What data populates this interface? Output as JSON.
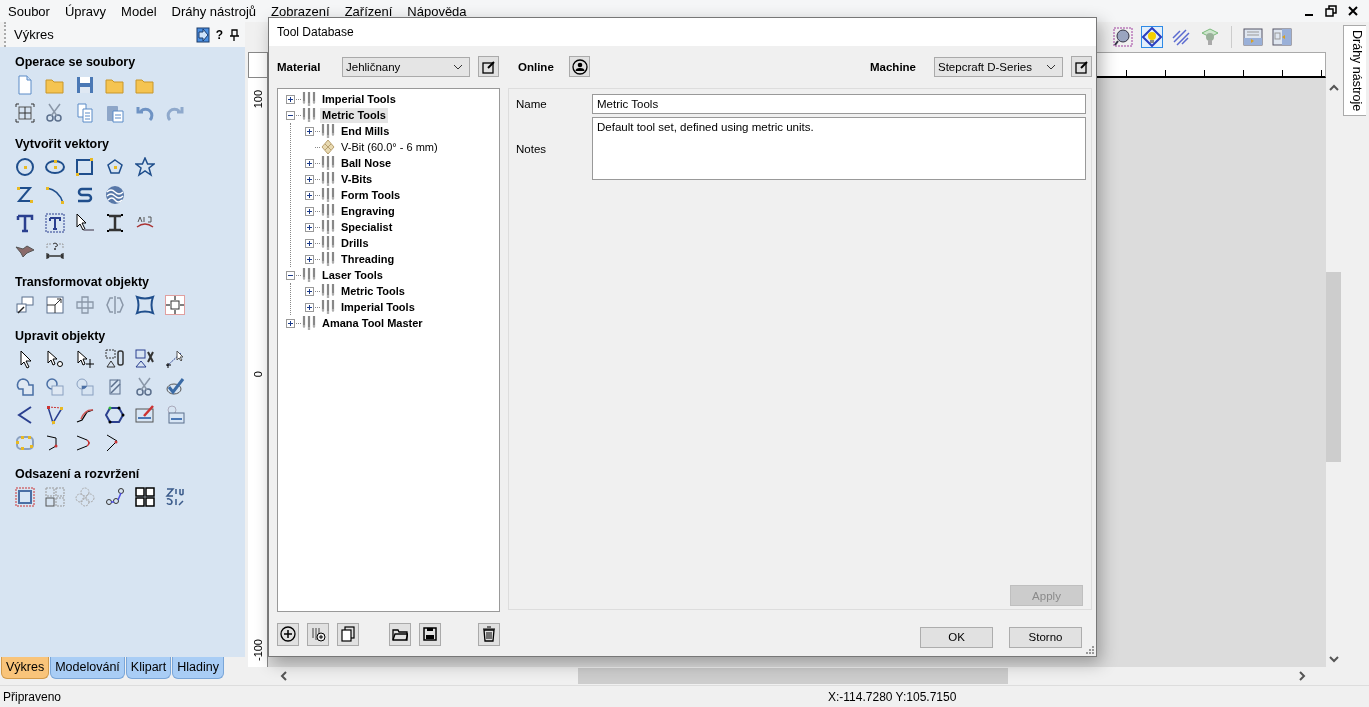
{
  "menu": [
    "Soubor",
    "Úpravy",
    "Model",
    "Dráhy nástrojů",
    "Zobrazení",
    "Zařízení",
    "Nápověda"
  ],
  "left_panel": {
    "title": "Výkres",
    "help": "?",
    "sections": [
      "Operace se soubory",
      "Vytvořit vektory",
      "Transformovat objekty",
      "Upravit objekty",
      "Odsazení a rozvržení"
    ]
  },
  "bottom_tabs": [
    {
      "label": "Výkres",
      "selected": true
    },
    {
      "label": "Modelování",
      "selected": false
    },
    {
      "label": "Klipart",
      "selected": false
    },
    {
      "label": "Hladiny",
      "selected": false
    }
  ],
  "toolbar_buttons": [
    {
      "selected": false
    },
    {
      "selected": true
    },
    {
      "selected": false
    },
    {
      "selected": false
    },
    {
      "selected": false
    },
    {
      "selected": false
    }
  ],
  "ruler_labels": [
    "100",
    "0",
    "-100"
  ],
  "right_tab": {
    "label": "Dráhy nástroje"
  },
  "dialog": {
    "title": "Tool Database",
    "material": {
      "label": "Material",
      "value": "Jehličnany"
    },
    "online": {
      "label": "Online"
    },
    "machine": {
      "label": "Machine",
      "value": "Stepcraft D-Series"
    },
    "tree": [
      {
        "label": "Imperial Tools",
        "kind": "group",
        "expanded": false,
        "selected": false
      },
      {
        "label": "Metric Tools",
        "kind": "group",
        "expanded": true,
        "selected": true,
        "children": [
          {
            "label": "End Mills",
            "kind": "group",
            "expanded": false,
            "selected": false
          },
          {
            "label": "V-Bit (60.0° - 6 mm)",
            "kind": "tool",
            "selected": false
          },
          {
            "label": "Ball Nose",
            "kind": "group",
            "expanded": false,
            "selected": false
          },
          {
            "label": "V-Bits",
            "kind": "group",
            "expanded": false,
            "selected": false
          },
          {
            "label": "Form Tools",
            "kind": "group",
            "expanded": false,
            "selected": false
          },
          {
            "label": "Engraving",
            "kind": "group",
            "expanded": false,
            "selected": false
          },
          {
            "label": "Specialist",
            "kind": "group",
            "expanded": false,
            "selected": false
          },
          {
            "label": "Drills",
            "kind": "group",
            "expanded": false,
            "selected": false
          },
          {
            "label": "Threading",
            "kind": "group",
            "expanded": false,
            "selected": false
          }
        ]
      },
      {
        "label": "Laser Tools",
        "kind": "group",
        "expanded": true,
        "selected": false,
        "children": [
          {
            "label": "Metric Tools",
            "kind": "group",
            "expanded": false,
            "selected": false
          },
          {
            "label": "Imperial Tools",
            "kind": "group",
            "expanded": false,
            "selected": false
          }
        ]
      },
      {
        "label": "Amana Tool Master",
        "kind": "group",
        "expanded": false,
        "selected": false
      }
    ],
    "details": {
      "name_label": "Name",
      "name_value": "Metric Tools",
      "notes_label": "Notes",
      "notes_value": "Default tool set, defined using metric units."
    },
    "apply": {
      "label": "Apply",
      "disabled": true
    },
    "buttons": [
      "OK",
      "Storno"
    ]
  },
  "status_bar": {
    "message": "Připraveno",
    "coordinates": "X:-114.7280 Y:105.7150"
  }
}
